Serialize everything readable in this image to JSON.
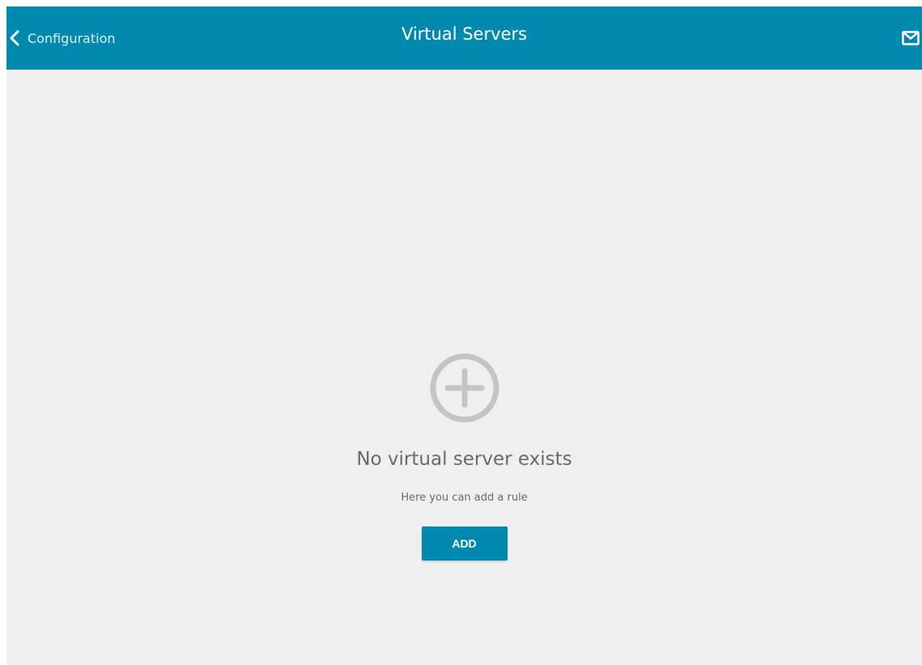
{
  "header": {
    "back_label": "Configuration",
    "back_icon": "chevron-left-icon",
    "title": "Virtual Servers",
    "mail_icon": "mail-icon"
  },
  "empty_state": {
    "icon": "plus-circle-icon",
    "title": "No virtual server exists",
    "subtitle": "Here you can add a rule",
    "add_button_label": "ADD"
  },
  "colors": {
    "accent": "#0089ae",
    "background": "#efefef",
    "text_muted": "#6a6a6a",
    "icon_muted": "#c4c4c4"
  }
}
